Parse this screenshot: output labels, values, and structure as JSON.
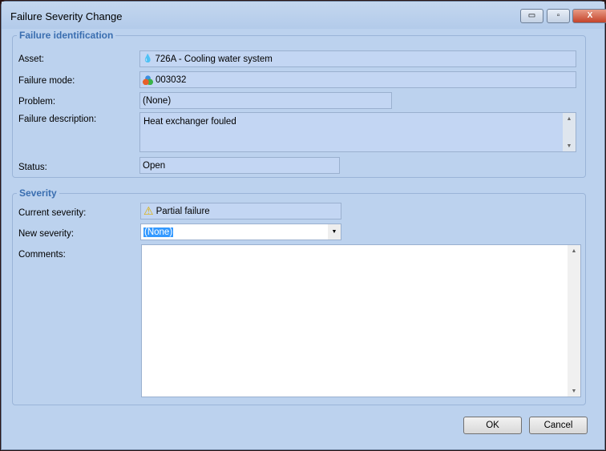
{
  "window": {
    "title": "Failure Severity Change",
    "minimize": "▭",
    "maximize": "▫",
    "close": "X"
  },
  "identification": {
    "legend": "Failure identification",
    "asset_label": "Asset:",
    "asset_value": "726A - Cooling water system",
    "mode_label": "Failure mode:",
    "mode_value": "003032",
    "problem_label": "Problem:",
    "problem_value": "(None)",
    "description_label": "Failure description:",
    "description_value": "Heat exchanger fouled",
    "status_label": "Status:",
    "status_value": "Open"
  },
  "severity": {
    "legend": "Severity",
    "current_label": "Current severity:",
    "current_value": "Partial failure",
    "new_label": "New severity:",
    "new_value": "(None)",
    "comments_label": "Comments:",
    "comments_value": ""
  },
  "buttons": {
    "ok": "OK",
    "cancel": "Cancel"
  }
}
